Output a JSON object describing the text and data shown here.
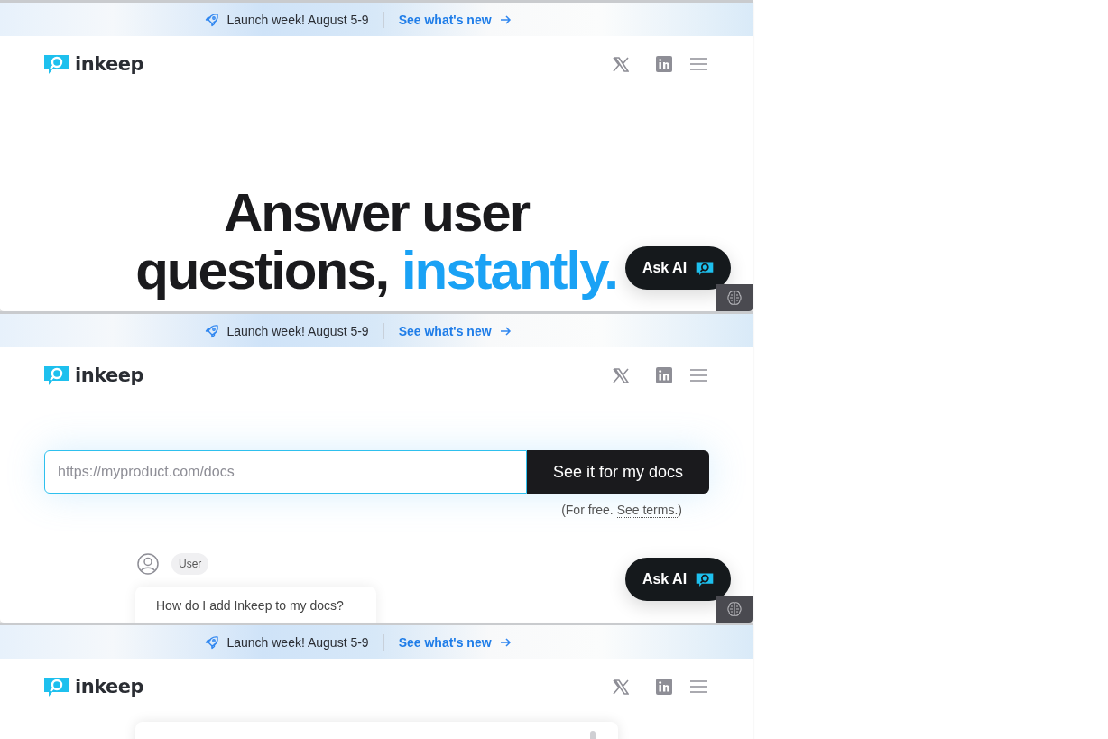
{
  "frames": [
    {
      "kind": "hero",
      "banner": {
        "announcement": "Launch week! August 5-9",
        "link": "See what's new"
      },
      "brand": "inkeep",
      "headline": {
        "line_1": "Answer user",
        "line_2": "questions,",
        "highlight": "instantly."
      },
      "ask_ai": "Ask AI"
    },
    {
      "kind": "form",
      "banner": {
        "announcement": "Launch week! August 5-9",
        "link": "See what's new"
      },
      "brand": "inkeep",
      "url_field": {
        "placeholder": "https://myproduct.com/docs"
      },
      "submit": "See it for my docs",
      "note": {
        "before": "(For free.",
        "link": "See terms.",
        "after": ")"
      },
      "role_label": "User",
      "question": "How do I add Inkeep to my docs?",
      "ask_ai": "Ask AI"
    },
    {
      "kind": "card",
      "banner": {
        "announcement": "Launch week! August 5-9",
        "link": "See what's new"
      },
      "brand": "inkeep"
    }
  ]
}
